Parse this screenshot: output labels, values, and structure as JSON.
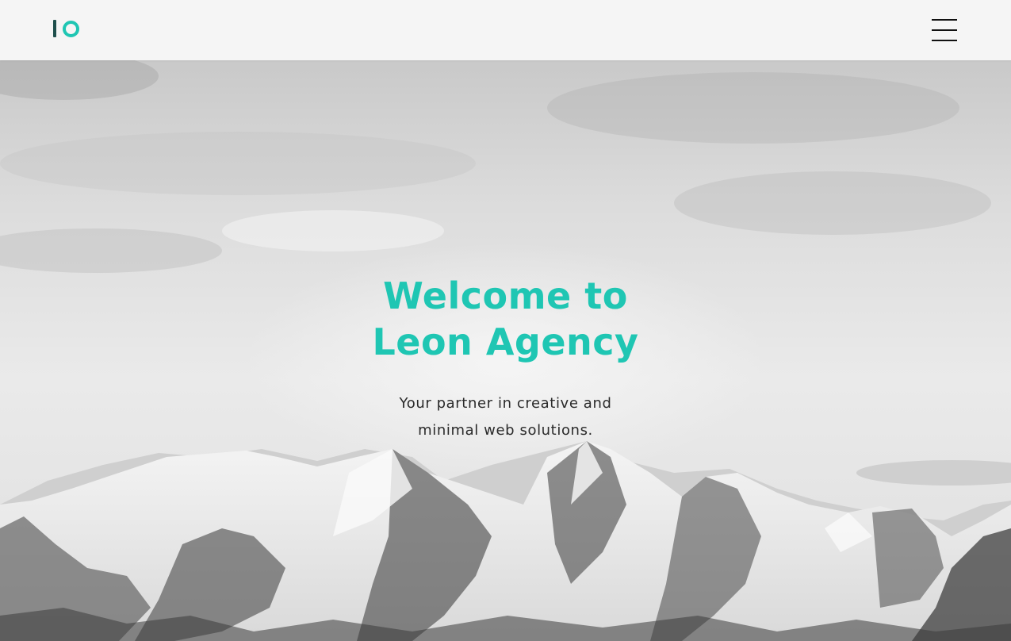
{
  "header": {
    "logo_icon": "io-logo-icon",
    "menu_icon": "hamburger-menu-icon",
    "colors": {
      "logo_bar": "#1f4f4c",
      "logo_ring": "#1fc6b3"
    }
  },
  "hero": {
    "title_line1": "Welcome to",
    "title_line2": "Leon Agency",
    "subtitle_line1": "Your partner in creative and",
    "subtitle_line2": "minimal web solutions.",
    "background": "snowy-mountains-image",
    "colors": {
      "accent": "#1fc6b3",
      "text": "#2a2a2a"
    }
  }
}
